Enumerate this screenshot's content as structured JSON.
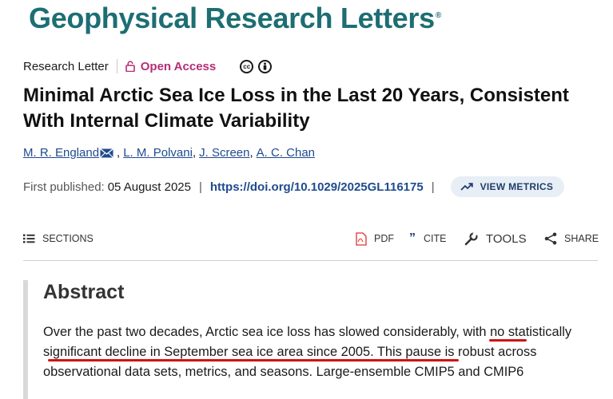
{
  "journal": {
    "name": "Geophysical Research Letters",
    "mark": "®"
  },
  "article": {
    "type": "Research Letter",
    "access": "Open Access",
    "license_icons": [
      "cc-icon",
      "by-icon"
    ],
    "title": "Minimal Arctic Sea Ice Loss in the Last 20 Years, Consistent With Internal Climate Variability",
    "authors": [
      "M. R. England",
      "L. M. Polvani",
      "J. Screen",
      "A. C. Chan"
    ],
    "published_label": "First published:",
    "published_date": "05 August 2025",
    "doi": "https://doi.org/10.1029/2025GL116175",
    "metrics_label": "VIEW METRICS"
  },
  "toolbar": {
    "sections": "SECTIONS",
    "pdf": "PDF",
    "cite": "CITE",
    "tools": "TOOLS",
    "share": "SHARE"
  },
  "abstract": {
    "heading": "Abstract",
    "text": "Over the past two decades, Arctic sea ice loss has slowed considerably, with no statistically significant decline in September sea ice area since 2005. This pause is robust across observational data sets, metrics, and seasons. Large-ensemble CMIP5 and CMIP6"
  },
  "colors": {
    "brand": "#1d6e73",
    "open_access": "#b52d75",
    "link": "#1f4b8f",
    "annotation": "#d21212"
  }
}
